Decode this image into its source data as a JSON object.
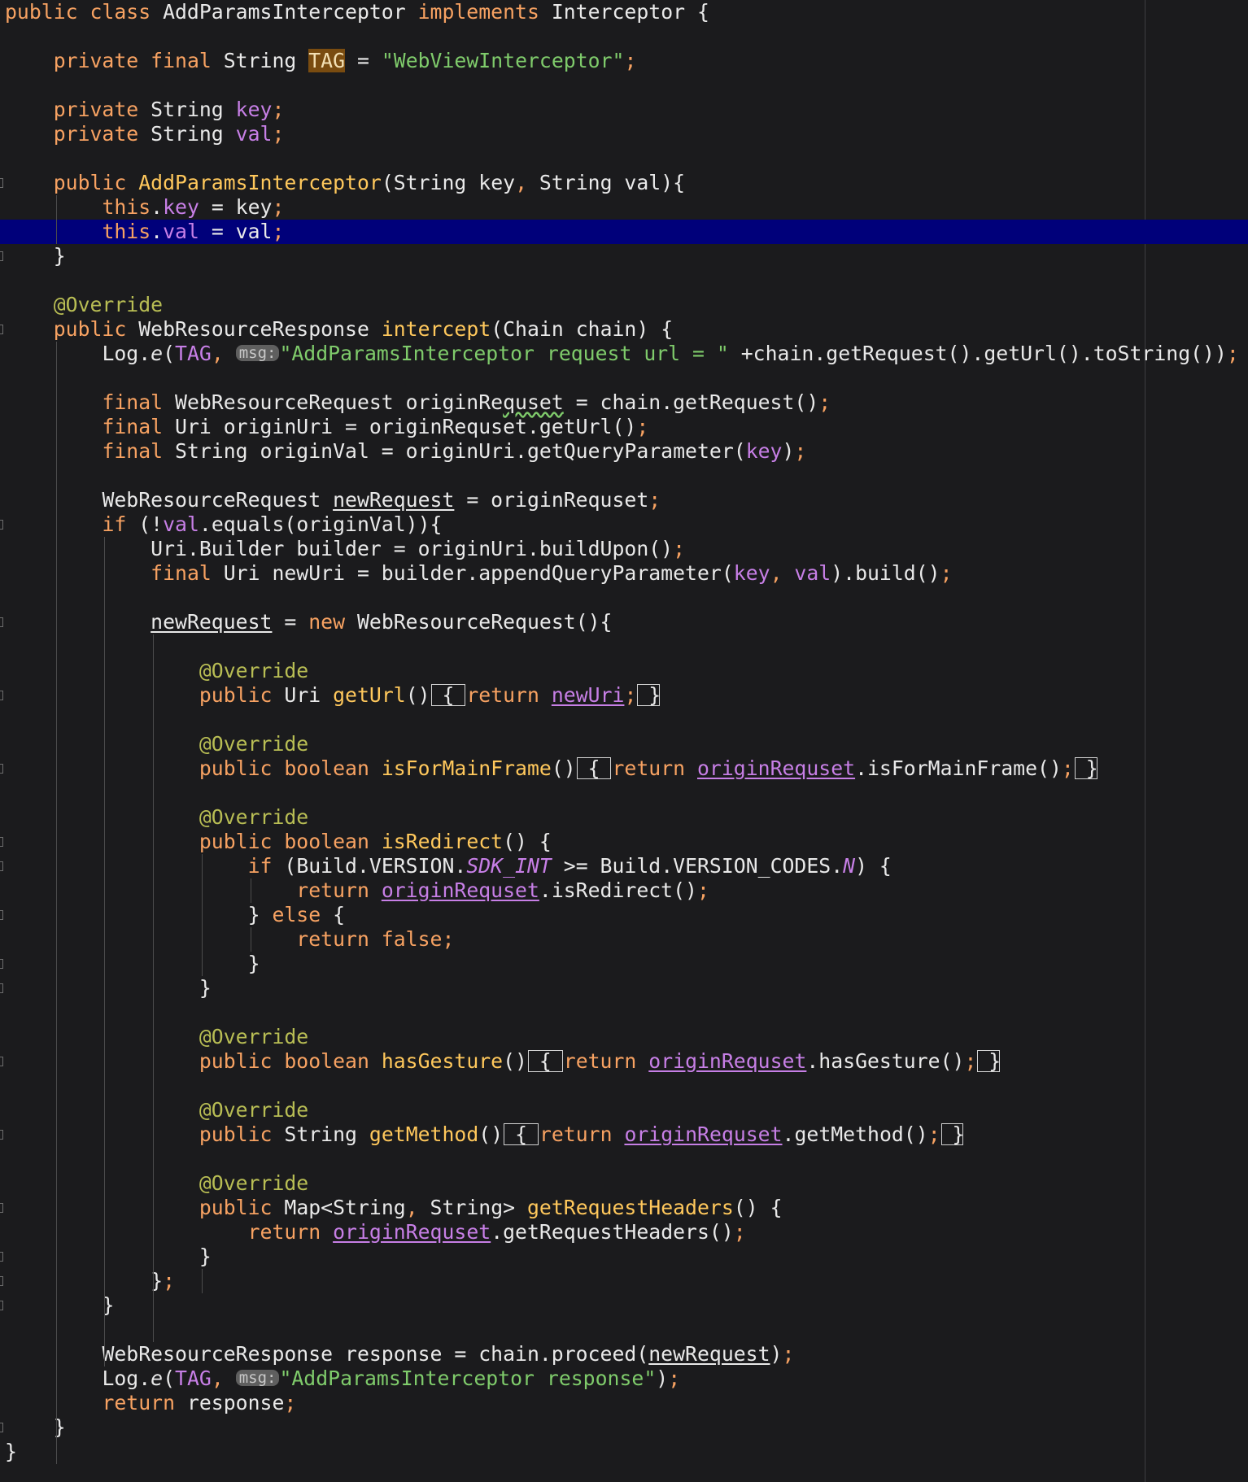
{
  "editor": {
    "lines": [
      {
        "indent": 0,
        "tokens": [
          {
            "t": "public class ",
            "c": "kw"
          },
          {
            "t": "AddParamsInterceptor "
          },
          {
            "t": "implements ",
            "c": "kw"
          },
          {
            "t": "Interceptor {"
          }
        ]
      },
      {
        "indent": 0,
        "tokens": []
      },
      {
        "indent": 4,
        "tokens": [
          {
            "t": "private final ",
            "c": "kw"
          },
          {
            "t": "String "
          },
          {
            "t": "TAG",
            "c": "tagbg"
          },
          {
            "t": " = "
          },
          {
            "t": "\"WebViewInterceptor\"",
            "c": "str"
          },
          {
            "t": ";",
            "c": "kw"
          }
        ]
      },
      {
        "indent": 0,
        "tokens": []
      },
      {
        "indent": 4,
        "tokens": [
          {
            "t": "private ",
            "c": "kw"
          },
          {
            "t": "String "
          },
          {
            "t": "key",
            "c": "fld"
          },
          {
            "t": ";",
            "c": "kw"
          }
        ]
      },
      {
        "indent": 4,
        "tokens": [
          {
            "t": "private ",
            "c": "kw"
          },
          {
            "t": "String "
          },
          {
            "t": "val",
            "c": "fld"
          },
          {
            "t": ";",
            "c": "kw"
          }
        ]
      },
      {
        "indent": 0,
        "tokens": []
      },
      {
        "indent": 4,
        "fold": true,
        "tokens": [
          {
            "t": "public ",
            "c": "kw"
          },
          {
            "t": "AddParamsInterceptor",
            "c": "fn"
          },
          {
            "t": "(String key"
          },
          {
            "t": ", ",
            "c": "kw"
          },
          {
            "t": "String val){"
          }
        ]
      },
      {
        "indent": 8,
        "tokens": [
          {
            "t": "this",
            "c": "kw"
          },
          {
            "t": "."
          },
          {
            "t": "key",
            "c": "fld"
          },
          {
            "t": " = key"
          },
          {
            "t": ";",
            "c": "kw"
          }
        ]
      },
      {
        "indent": 8,
        "hl": true,
        "tokens": [
          {
            "t": "this",
            "c": "kw"
          },
          {
            "t": "."
          },
          {
            "t": "val",
            "c": "fld"
          },
          {
            "t": " = val"
          },
          {
            "t": ";",
            "c": "kw"
          }
        ]
      },
      {
        "indent": 4,
        "fold": true,
        "tokens": [
          {
            "t": "}"
          }
        ]
      },
      {
        "indent": 0,
        "tokens": []
      },
      {
        "indent": 4,
        "tokens": [
          {
            "t": "@Override",
            "c": "ann"
          }
        ]
      },
      {
        "indent": 4,
        "fold": true,
        "tokens": [
          {
            "t": "public ",
            "c": "kw"
          },
          {
            "t": "WebResourceResponse "
          },
          {
            "t": "intercept",
            "c": "fn"
          },
          {
            "t": "(Chain chain) {"
          }
        ]
      },
      {
        "indent": 8,
        "tokens": [
          {
            "t": "Log."
          },
          {
            "t": "e",
            "c": "ital"
          },
          {
            "t": "("
          },
          {
            "t": "TAG",
            "c": "fld"
          },
          {
            "t": ", ",
            "c": "kw"
          },
          {
            "t": "msg:",
            "c": "hint"
          },
          {
            "t": "\"AddParamsInterceptor request url = \"",
            "c": "str"
          },
          {
            "t": " +chain.getRequest().getUrl().toString())"
          },
          {
            "t": ";",
            "c": "kw"
          }
        ]
      },
      {
        "indent": 0,
        "tokens": []
      },
      {
        "indent": 8,
        "tokens": [
          {
            "t": "final ",
            "c": "kw"
          },
          {
            "t": "WebResourceRequest originRe"
          },
          {
            "t": "quset",
            "c": "wavy"
          },
          {
            "t": " = chain.getRequest()"
          },
          {
            "t": ";",
            "c": "kw"
          }
        ]
      },
      {
        "indent": 8,
        "tokens": [
          {
            "t": "final ",
            "c": "kw"
          },
          {
            "t": "Uri originUri = originRequset.getUrl()"
          },
          {
            "t": ";",
            "c": "kw"
          }
        ]
      },
      {
        "indent": 8,
        "tokens": [
          {
            "t": "final ",
            "c": "kw"
          },
          {
            "t": "String originVal = originUri.getQueryParameter("
          },
          {
            "t": "key",
            "c": "fld"
          },
          {
            "t": ")"
          },
          {
            "t": ";",
            "c": "kw"
          }
        ]
      },
      {
        "indent": 0,
        "tokens": []
      },
      {
        "indent": 8,
        "tokens": [
          {
            "t": "WebResourceRequest "
          },
          {
            "t": "newRequest",
            "c": "ul"
          },
          {
            "t": " = originRequset"
          },
          {
            "t": ";",
            "c": "kw"
          }
        ]
      },
      {
        "indent": 8,
        "fold": true,
        "tokens": [
          {
            "t": "if ",
            "c": "kw"
          },
          {
            "t": "(!"
          },
          {
            "t": "val",
            "c": "fld"
          },
          {
            "t": ".equals(originVal)){"
          }
        ]
      },
      {
        "indent": 12,
        "tokens": [
          {
            "t": "Uri.Builder builder = originUri.buildUpon()"
          },
          {
            "t": ";",
            "c": "kw"
          }
        ]
      },
      {
        "indent": 12,
        "tokens": [
          {
            "t": "final ",
            "c": "kw"
          },
          {
            "t": "Uri newUri = builder.appendQueryParameter("
          },
          {
            "t": "key",
            "c": "fld"
          },
          {
            "t": ", ",
            "c": "kw"
          },
          {
            "t": "val",
            "c": "fld"
          },
          {
            "t": ").build()"
          },
          {
            "t": ";",
            "c": "kw"
          }
        ]
      },
      {
        "indent": 0,
        "tokens": []
      },
      {
        "indent": 12,
        "fold": true,
        "tokens": [
          {
            "t": "newRequest",
            "c": "ul"
          },
          {
            "t": " = "
          },
          {
            "t": "new ",
            "c": "kw"
          },
          {
            "t": "WebResourceRequest(){"
          }
        ]
      },
      {
        "indent": 0,
        "tokens": []
      },
      {
        "indent": 16,
        "tokens": [
          {
            "t": "@Override",
            "c": "ann"
          }
        ]
      },
      {
        "indent": 16,
        "fold": true,
        "tokens": [
          {
            "t": "public ",
            "c": "kw"
          },
          {
            "t": "Uri "
          },
          {
            "t": "getUrl",
            "c": "fn"
          },
          {
            "t": "()"
          },
          {
            "t": " { ",
            "c": "fb"
          },
          {
            "t": "return ",
            "c": "kw"
          },
          {
            "t": "newUri",
            "c": "fld ul"
          },
          {
            "t": ";",
            "c": "kw"
          },
          {
            "t": " }",
            "c": "fb"
          }
        ]
      },
      {
        "indent": 0,
        "tokens": []
      },
      {
        "indent": 16,
        "tokens": [
          {
            "t": "@Override",
            "c": "ann"
          }
        ]
      },
      {
        "indent": 16,
        "fold": true,
        "tokens": [
          {
            "t": "public boolean ",
            "c": "kw"
          },
          {
            "t": "isForMainFrame",
            "c": "fn"
          },
          {
            "t": "()"
          },
          {
            "t": " { ",
            "c": "fb"
          },
          {
            "t": "return ",
            "c": "kw"
          },
          {
            "t": "originRequset",
            "c": "fld ul"
          },
          {
            "t": ".isForMainFrame()"
          },
          {
            "t": ";",
            "c": "kw"
          },
          {
            "t": " }",
            "c": "fb"
          }
        ]
      },
      {
        "indent": 0,
        "tokens": []
      },
      {
        "indent": 16,
        "tokens": [
          {
            "t": "@Override",
            "c": "ann"
          }
        ]
      },
      {
        "indent": 16,
        "fold": true,
        "tokens": [
          {
            "t": "public boolean ",
            "c": "kw"
          },
          {
            "t": "isRedirect",
            "c": "fn"
          },
          {
            "t": "() {"
          }
        ]
      },
      {
        "indent": 20,
        "fold": true,
        "tokens": [
          {
            "t": "if ",
            "c": "kw"
          },
          {
            "t": "(Build.VERSION."
          },
          {
            "t": "SDK_INT",
            "c": "stat"
          },
          {
            "t": " >= Build.VERSION_CODES."
          },
          {
            "t": "N",
            "c": "stat"
          },
          {
            "t": ") {"
          }
        ]
      },
      {
        "indent": 24,
        "tokens": [
          {
            "t": "return ",
            "c": "kw"
          },
          {
            "t": "originRequset",
            "c": "fld ul"
          },
          {
            "t": ".isRedirect()"
          },
          {
            "t": ";",
            "c": "kw"
          }
        ]
      },
      {
        "indent": 20,
        "fold": true,
        "tokens": [
          {
            "t": "} "
          },
          {
            "t": "else ",
            "c": "kw"
          },
          {
            "t": "{"
          }
        ]
      },
      {
        "indent": 24,
        "tokens": [
          {
            "t": "return false;",
            "c": "kw"
          }
        ]
      },
      {
        "indent": 20,
        "fold": true,
        "tokens": [
          {
            "t": "}"
          }
        ]
      },
      {
        "indent": 16,
        "fold": true,
        "tokens": [
          {
            "t": "}"
          }
        ]
      },
      {
        "indent": 0,
        "tokens": []
      },
      {
        "indent": 16,
        "tokens": [
          {
            "t": "@Override",
            "c": "ann"
          }
        ]
      },
      {
        "indent": 16,
        "fold": true,
        "tokens": [
          {
            "t": "public boolean ",
            "c": "kw"
          },
          {
            "t": "hasGesture",
            "c": "fn"
          },
          {
            "t": "()"
          },
          {
            "t": " { ",
            "c": "fb"
          },
          {
            "t": "return ",
            "c": "kw"
          },
          {
            "t": "originRequset",
            "c": "fld ul"
          },
          {
            "t": ".hasGesture()"
          },
          {
            "t": ";",
            "c": "kw"
          },
          {
            "t": " }",
            "c": "fb"
          }
        ]
      },
      {
        "indent": 0,
        "tokens": []
      },
      {
        "indent": 16,
        "tokens": [
          {
            "t": "@Override",
            "c": "ann"
          }
        ]
      },
      {
        "indent": 16,
        "fold": true,
        "tokens": [
          {
            "t": "public ",
            "c": "kw"
          },
          {
            "t": "String "
          },
          {
            "t": "getMethod",
            "c": "fn"
          },
          {
            "t": "()"
          },
          {
            "t": " { ",
            "c": "fb"
          },
          {
            "t": "return ",
            "c": "kw"
          },
          {
            "t": "originRequset",
            "c": "fld ul"
          },
          {
            "t": ".getMethod()"
          },
          {
            "t": ";",
            "c": "kw"
          },
          {
            "t": " }",
            "c": "fb"
          }
        ]
      },
      {
        "indent": 0,
        "tokens": []
      },
      {
        "indent": 16,
        "tokens": [
          {
            "t": "@Override",
            "c": "ann"
          }
        ]
      },
      {
        "indent": 16,
        "fold": true,
        "tokens": [
          {
            "t": "public ",
            "c": "kw"
          },
          {
            "t": "Map<String"
          },
          {
            "t": ", ",
            "c": "kw"
          },
          {
            "t": "String> "
          },
          {
            "t": "getRequestHeaders",
            "c": "fn"
          },
          {
            "t": "() {"
          }
        ]
      },
      {
        "indent": 20,
        "tokens": [
          {
            "t": "return ",
            "c": "kw"
          },
          {
            "t": "originRequset",
            "c": "fld ul"
          },
          {
            "t": ".getRequestHeaders()"
          },
          {
            "t": ";",
            "c": "kw"
          }
        ]
      },
      {
        "indent": 16,
        "fold": true,
        "tokens": [
          {
            "t": "}"
          }
        ]
      },
      {
        "indent": 12,
        "fold": true,
        "tokens": [
          {
            "t": "}"
          },
          {
            "t": ";",
            "c": "kw"
          }
        ]
      },
      {
        "indent": 8,
        "fold": true,
        "tokens": [
          {
            "t": "}"
          }
        ]
      },
      {
        "indent": 0,
        "tokens": []
      },
      {
        "indent": 8,
        "tokens": [
          {
            "t": "WebResourceResponse response = chain.proceed("
          },
          {
            "t": "newRequest",
            "c": "ul"
          },
          {
            "t": ")"
          },
          {
            "t": ";",
            "c": "kw"
          }
        ]
      },
      {
        "indent": 8,
        "tokens": [
          {
            "t": "Log."
          },
          {
            "t": "e",
            "c": "ital"
          },
          {
            "t": "("
          },
          {
            "t": "TAG",
            "c": "fld"
          },
          {
            "t": ", ",
            "c": "kw"
          },
          {
            "t": "msg:",
            "c": "hint"
          },
          {
            "t": "\"AddParamsInterceptor response\"",
            "c": "str"
          },
          {
            "t": ")"
          },
          {
            "t": ";",
            "c": "kw"
          }
        ]
      },
      {
        "indent": 8,
        "tokens": [
          {
            "t": "return ",
            "c": "kw"
          },
          {
            "t": "response"
          },
          {
            "t": ";",
            "c": "kw"
          }
        ]
      },
      {
        "indent": 4,
        "fold": true,
        "tokens": [
          {
            "t": "}"
          }
        ]
      },
      {
        "indent": 0,
        "tokens": [
          {
            "t": "}"
          }
        ]
      }
    ],
    "indent_guides": [
      {
        "col": 4,
        "from": 8,
        "to": 9
      },
      {
        "col": 4,
        "from": 14,
        "to": 59
      },
      {
        "col": 8,
        "from": 22,
        "to": 55
      },
      {
        "col": 12,
        "from": 26,
        "to": 54
      },
      {
        "col": 16,
        "from": 35,
        "to": 39
      },
      {
        "col": 20,
        "from": 36,
        "to": 36
      },
      {
        "col": 20,
        "from": 38,
        "to": 38
      },
      {
        "col": 16,
        "from": 52,
        "to": 52
      }
    ]
  }
}
